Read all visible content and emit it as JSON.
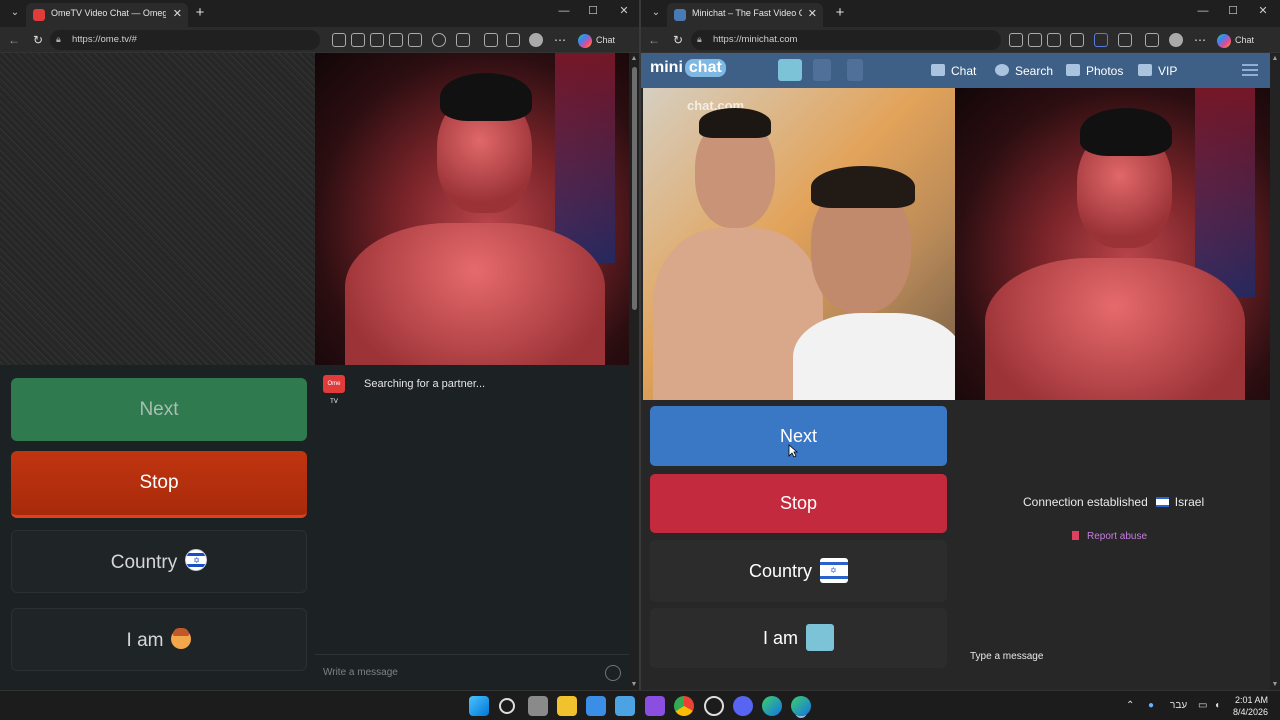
{
  "left_window": {
    "tab_title": "OmeTV Video Chat — Omegle",
    "url": "https://ome.tv/#",
    "copilot_label": "Chat",
    "buttons": {
      "next": "Next",
      "stop": "Stop",
      "country": "Country",
      "iam": "I am"
    },
    "logo_text": "Ome TV",
    "status": "Searching for a partner...",
    "message_placeholder": "Write a message",
    "colors": {
      "next": "#2f7a4f",
      "stop": "#c13510",
      "panel": "#1c2124"
    }
  },
  "right_window": {
    "tab_title": "Minichat – The Fast Video Chat",
    "url": "https://minichat.com",
    "copilot_label": "Chat",
    "logo": {
      "mini": "mini",
      "chat": "chat"
    },
    "nav": {
      "chat": "Chat",
      "search": "Search",
      "photos": "Photos",
      "vip": "VIP"
    },
    "watermark": "chat.com",
    "buttons": {
      "next": "Next",
      "stop": "Stop",
      "country": "Country",
      "iam": "I am"
    },
    "connection": "Connection established",
    "country_name": "Israel",
    "report": "Report abuse",
    "type_message": "Type a message",
    "colors": {
      "next": "#3a78c6",
      "stop": "#c42a3e",
      "header": "#3e5f86"
    }
  },
  "taskbar": {
    "language": "עבר",
    "time": "2:01 AM",
    "date": "8/4/2026"
  }
}
